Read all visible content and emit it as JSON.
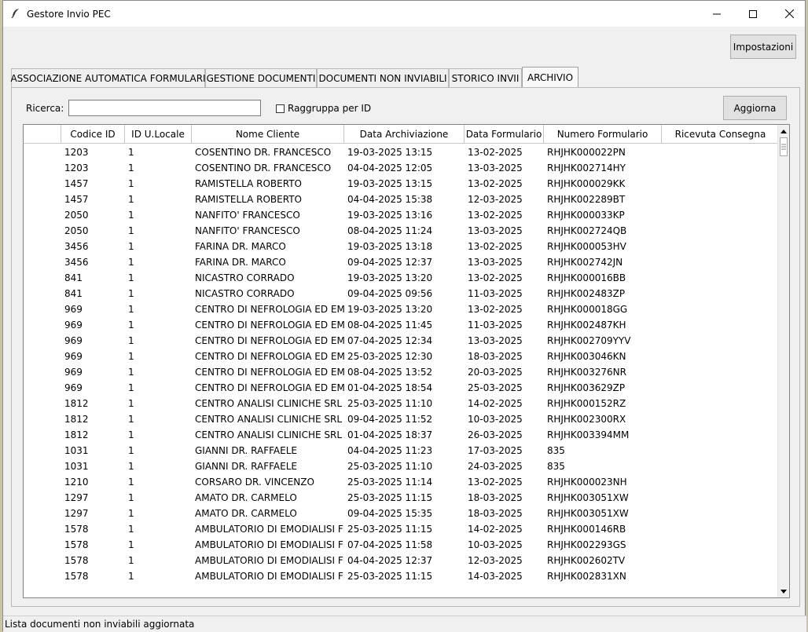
{
  "window": {
    "title": "Gestore Invio PEC",
    "app_icon": "feather-icon"
  },
  "toolbar": {
    "settings_label": "Impostazioni"
  },
  "tabs": [
    {
      "label": "ASSOCIAZIONE AUTOMATICA FORMULARI",
      "active": false
    },
    {
      "label": "GESTIONE DOCUMENTI",
      "active": false
    },
    {
      "label": "DOCUMENTI NON INVIABILI",
      "active": false
    },
    {
      "label": "STORICO INVII",
      "active": false
    },
    {
      "label": "ARCHIVIO",
      "active": true
    }
  ],
  "search": {
    "label": "Ricerca:",
    "value": "",
    "group_label": "Raggruppa per ID",
    "group_checked": false,
    "refresh_label": "Aggiorna"
  },
  "table": {
    "columns": [
      "",
      "Codice ID",
      "ID U.Locale",
      "Nome Cliente",
      "Data Archiviazione",
      "Data Formulario",
      "Numero Formulario",
      "Ricevuta Consegna"
    ],
    "rows": [
      [
        "1203",
        "1",
        "COSENTINO DR. FRANCESCO",
        "19-03-2025 13:15",
        "13-02-2025",
        "RHJHK000022PN",
        ""
      ],
      [
        "1203",
        "1",
        "COSENTINO DR. FRANCESCO",
        "04-04-2025 12:05",
        "13-03-2025",
        "RHJHK002714HY",
        ""
      ],
      [
        "1457",
        "1",
        "RAMISTELLA ROBERTO",
        "19-03-2025 13:15",
        "13-02-2025",
        "RHJHK000029KK",
        ""
      ],
      [
        "1457",
        "1",
        "RAMISTELLA ROBERTO",
        "04-04-2025 15:38",
        "12-03-2025",
        "RHJHK002289BT",
        ""
      ],
      [
        "2050",
        "1",
        "NANFITO'  FRANCESCO",
        "19-03-2025 13:16",
        "13-02-2025",
        "RHJHK000033KP",
        ""
      ],
      [
        "2050",
        "1",
        "NANFITO'  FRANCESCO",
        "08-04-2025 11:24",
        "13-03-2025",
        "RHJHK002724QB",
        ""
      ],
      [
        "3456",
        "1",
        "FARINA DR. MARCO",
        "19-03-2025 13:18",
        "13-02-2025",
        "RHJHK000053HV",
        ""
      ],
      [
        "3456",
        "1",
        "FARINA DR. MARCO",
        "09-04-2025 12:37",
        "13-03-2025",
        "RHJHK002742JN",
        ""
      ],
      [
        "841",
        "1",
        "NICASTRO  CORRADO",
        "19-03-2025 13:20",
        "13-02-2025",
        "RHJHK000016BB",
        ""
      ],
      [
        "841",
        "1",
        "NICASTRO  CORRADO",
        "09-04-2025 09:56",
        "11-03-2025",
        "RHJHK002483ZP",
        ""
      ],
      [
        "969",
        "1",
        "CENTRO DI NEFROLOGIA ED EMOD",
        "19-03-2025 13:20",
        "13-02-2025",
        "RHJHK000018GG",
        ""
      ],
      [
        "969",
        "1",
        "CENTRO DI NEFROLOGIA ED EMOD",
        "08-04-2025 11:45",
        "11-03-2025",
        "RHJHK002487KH",
        ""
      ],
      [
        "969",
        "1",
        "CENTRO DI NEFROLOGIA ED EMOD",
        "07-04-2025 12:34",
        "13-03-2025",
        "RHJHK002709YYV",
        ""
      ],
      [
        "969",
        "1",
        "CENTRO DI NEFROLOGIA ED EMOD",
        "25-03-2025 12:30",
        "18-03-2025",
        "RHJHK003046KN",
        ""
      ],
      [
        "969",
        "1",
        "CENTRO DI NEFROLOGIA ED EMOD",
        "08-04-2025 13:52",
        "20-03-2025",
        "RHJHK003276NR",
        ""
      ],
      [
        "969",
        "1",
        "CENTRO DI NEFROLOGIA ED EMOD",
        "01-04-2025 18:54",
        "25-03-2025",
        "RHJHK003629ZP",
        ""
      ],
      [
        "1812",
        "1",
        "CENTRO ANALISI CLINICHE SRL",
        "25-03-2025 11:10",
        "14-02-2025",
        "RHJHK000152RZ",
        ""
      ],
      [
        "1812",
        "1",
        "CENTRO ANALISI CLINICHE SRL",
        "09-04-2025 11:52",
        "10-03-2025",
        "RHJHK002300RX",
        ""
      ],
      [
        "1812",
        "1",
        "CENTRO ANALISI CLINICHE SRL",
        "01-04-2025 18:37",
        "26-03-2025",
        "RHJHK003394MM",
        ""
      ],
      [
        "1031",
        "1",
        "GIANNI DR. RAFFAELE",
        "04-04-2025 11:23",
        "17-03-2025",
        "835",
        ""
      ],
      [
        "1031",
        "1",
        "GIANNI DR. RAFFAELE",
        "25-03-2025 11:10",
        "24-03-2025",
        "835",
        ""
      ],
      [
        "1210",
        "1",
        "CORSARO DR. VINCENZO",
        "25-03-2025 11:14",
        "13-02-2025",
        "RHJHK000023NH",
        ""
      ],
      [
        "1297",
        "1",
        "AMATO DR. CARMELO",
        "25-03-2025 11:15",
        "18-03-2025",
        "RHJHK003051XW",
        ""
      ],
      [
        "1297",
        "1",
        "AMATO DR. CARMELO",
        "09-04-2025 15:35",
        "18-03-2025",
        "RHJHK003051XW",
        ""
      ],
      [
        "1578",
        "1",
        "AMBULATORIO DI EMODIALISI FLO",
        "25-03-2025 11:15",
        "14-02-2025",
        "RHJHK000146RB",
        ""
      ],
      [
        "1578",
        "1",
        "AMBULATORIO DI EMODIALISI FLO",
        "07-04-2025 11:58",
        "10-03-2025",
        "RHJHK002293GS",
        ""
      ],
      [
        "1578",
        "1",
        "AMBULATORIO DI EMODIALISI FLO",
        "04-04-2025 12:37",
        "12-03-2025",
        "RHJHK002602TV",
        ""
      ],
      [
        "1578",
        "1",
        "AMBULATORIO DI EMODIALISI FLO",
        "25-03-2025 11:15",
        "14-03-2025",
        "RHJHK002831XN",
        ""
      ]
    ]
  },
  "status": {
    "text": "Lista documenti non inviabili aggiornata"
  }
}
